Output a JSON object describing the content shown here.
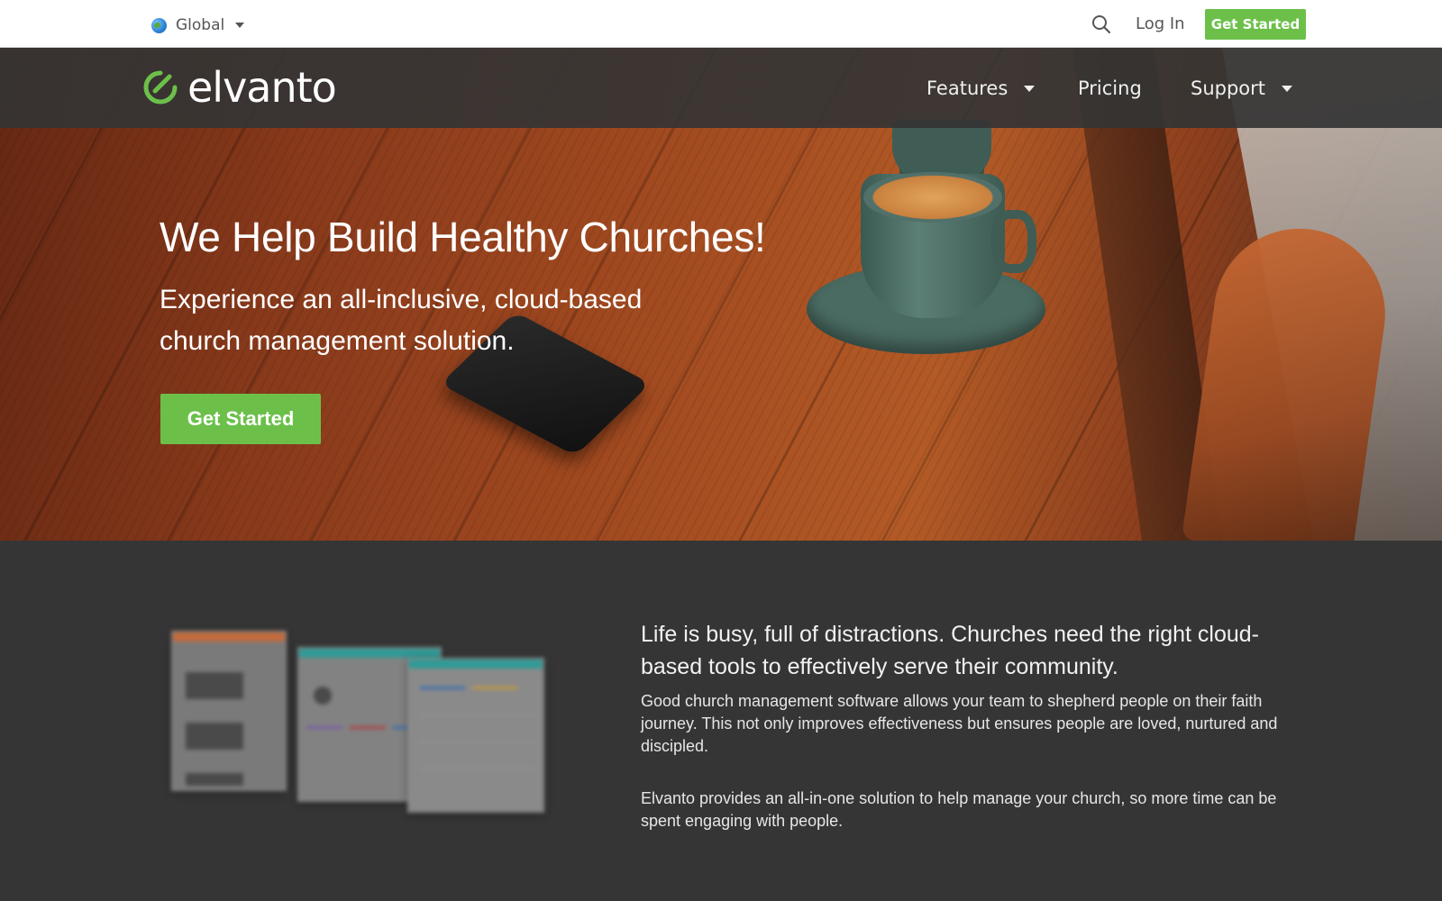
{
  "topbar": {
    "region_label": "Global",
    "login_label": "Log In",
    "cta_label": "Get Started"
  },
  "nav": {
    "logo_text": "elvanto",
    "items": [
      {
        "label": "Features",
        "has_dropdown": true
      },
      {
        "label": "Pricing",
        "has_dropdown": false
      },
      {
        "label": "Support",
        "has_dropdown": true
      }
    ]
  },
  "hero": {
    "title": "We Help Build Healthy Churches!",
    "subtitle": "Experience an all-inclusive, cloud-based church management solution.",
    "cta_label": "Get Started"
  },
  "intro": {
    "lead": "Life is busy, full of distractions. Churches need the right cloud-based tools to effectively serve their community.",
    "paragraph1": "Good church management software allows your team to shepherd people on their faith journey. This not only improves effectiveness but ensures people are loved, nurtured and discipled.",
    "paragraph2": "Elvanto provides an all-in-one solution to help manage your church, so more time can be spent engaging with people."
  },
  "colors": {
    "brand_green": "#6cc04a",
    "nav_bg": "#343434",
    "section_bg": "#353535"
  },
  "icons": [
    "globe-icon",
    "chevron-down-icon",
    "search-icon",
    "elvanto-logo-icon"
  ]
}
